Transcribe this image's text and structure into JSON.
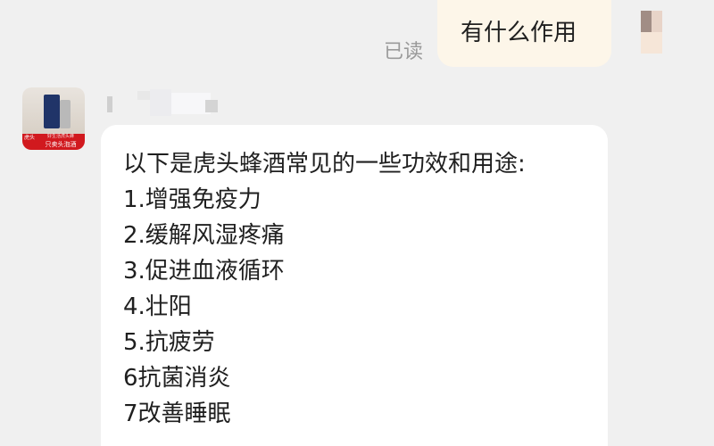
{
  "chat": {
    "outgoing": {
      "read_status": "已读",
      "text": "有什么作用"
    },
    "incoming": {
      "avatar_badge": "虎头",
      "avatar_banner_small": "好生活虎头蜂",
      "avatar_banner_main": "只卖头泡酒",
      "lines": [
        "以下是虎头蜂酒常见的一些功效和用途:",
        "1.增强免疫力",
        "2.缓解风湿疼痛",
        "3.促进血液循环",
        "4.壮阳",
        "5.抗疲劳",
        "6抗菌消炎",
        "7改善睡眠"
      ]
    }
  },
  "colors": {
    "background": "#f0f0f0",
    "outgoing_bubble": "#fdf6e9",
    "incoming_bubble": "#ffffff",
    "read_status": "#9a9a9a",
    "brand_red": "#d1191e"
  }
}
